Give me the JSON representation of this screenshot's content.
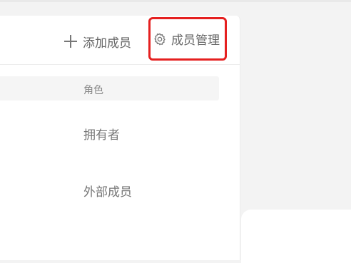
{
  "header": {
    "add_member_label": "添加成员",
    "member_management_label": "成员管理"
  },
  "table": {
    "columns": [
      "角色"
    ],
    "rows": [
      {
        "role": "拥有者"
      },
      {
        "role": "外部成员"
      }
    ]
  },
  "colors": {
    "highlight": "#e52020",
    "text": "#666666",
    "header_bg": "#f5f5f5"
  },
  "icons": {
    "add": "plus-icon",
    "manage": "gear-icon"
  }
}
